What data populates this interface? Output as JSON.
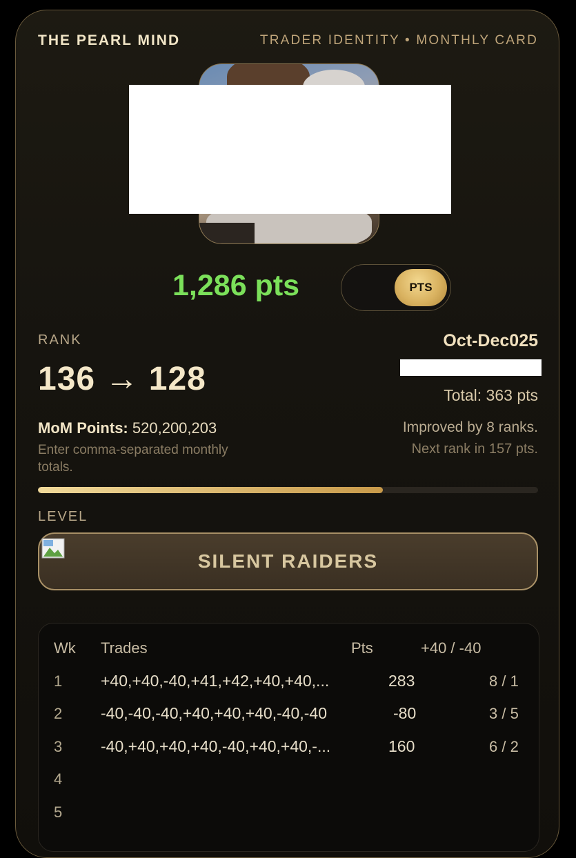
{
  "header": {
    "brand": "THE PEARL MIND",
    "subtitle": "TRADER IDENTITY • MONTHLY CARD"
  },
  "points": {
    "value": "1,286 pts",
    "toggle_label": "PTS"
  },
  "rank": {
    "label": "RANK",
    "value": "136 → 128",
    "period": "Oct-Dec025",
    "total": "Total: 363 pts",
    "improved": "Improved by 8 ranks.",
    "next_rank": "Next rank in 157 pts.",
    "progress": 0.69
  },
  "mom": {
    "label": "MoM Points:",
    "value": "520,200,203",
    "hint": "Enter comma-separated monthly totals."
  },
  "level": {
    "label": "LEVEL",
    "name": "SILENT RAIDERS"
  },
  "table": {
    "headers": [
      "Wk",
      "Trades",
      "Pts",
      "+40 / -40"
    ],
    "rows": [
      {
        "wk": "1",
        "trades": "+40,+40,-40,+41,+42,+40,+40,...",
        "pts": "283",
        "ratio": "8 / 1"
      },
      {
        "wk": "2",
        "trades": "-40,-40,-40,+40,+40,+40,-40,-40",
        "pts": "-80",
        "ratio": "3 / 5"
      },
      {
        "wk": "3",
        "trades": "-40,+40,+40,+40,-40,+40,+40,-...",
        "pts": "160",
        "ratio": "6 / 2"
      },
      {
        "wk": "4",
        "trades": "",
        "pts": "",
        "ratio": ""
      },
      {
        "wk": "5",
        "trades": "",
        "pts": "",
        "ratio": ""
      }
    ]
  },
  "colors": {
    "accent_gold": "#d9b260",
    "points_green": "#7be05a"
  }
}
